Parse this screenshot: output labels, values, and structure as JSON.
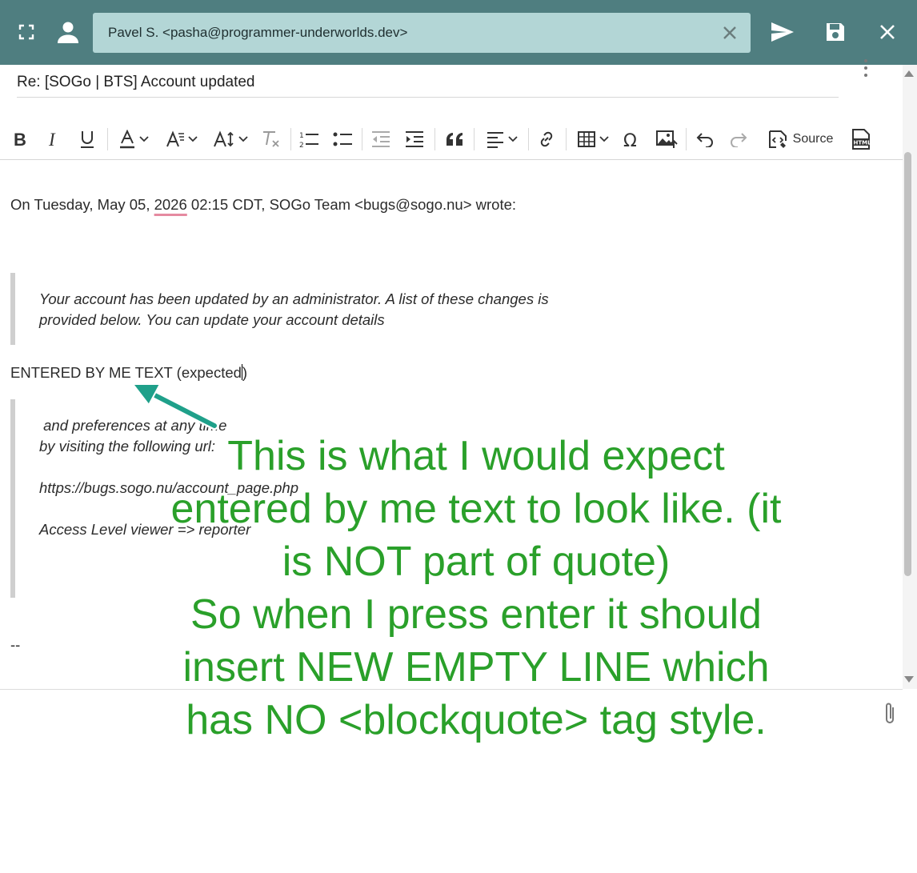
{
  "header": {
    "recipient": "Pavel S. <pasha@programmer-underworlds.dev>",
    "icons": [
      "fullscreen-icon",
      "contacts-icon",
      "remove-icon",
      "send-icon",
      "save-icon",
      "close-icon"
    ],
    "background_color": "#4f7e80",
    "chip_color": "#b3d6d6"
  },
  "subject": {
    "value": "Re: [SOGo | BTS] Account updated"
  },
  "toolbar": {
    "source_label": "Source",
    "html_badge": "HTML"
  },
  "editor": {
    "attribution_prefix": "On Tuesday, May 05, ",
    "attribution_year": "2026",
    "attribution_suffix": " 02:15 CDT, SOGo Team <bugs@sogo.nu> wrote:",
    "quote1": [
      "Your account has been updated by an administrator. A list of these changes is",
      "provided below. You can update your account details"
    ],
    "entered_text": "ENTERED BY ME TEXT (expected",
    "entered_text_close": ")",
    "quote2": [
      " and preferences at any time",
      "by visiting the following url:",
      "https://bugs.sogo.nu/account_page.php",
      "Access Level viewer => reporter"
    ],
    "signature": "--"
  },
  "annotation": {
    "lines": [
      "This is what I would expect",
      "entered by me text to look like. (it",
      "is NOT part of quote)",
      "So when I press enter it should",
      "insert NEW EMPTY LINE which",
      "has NO <blockquote> tag style."
    ],
    "color": "#2aa02a",
    "arrow_color": "#1fa08a"
  }
}
